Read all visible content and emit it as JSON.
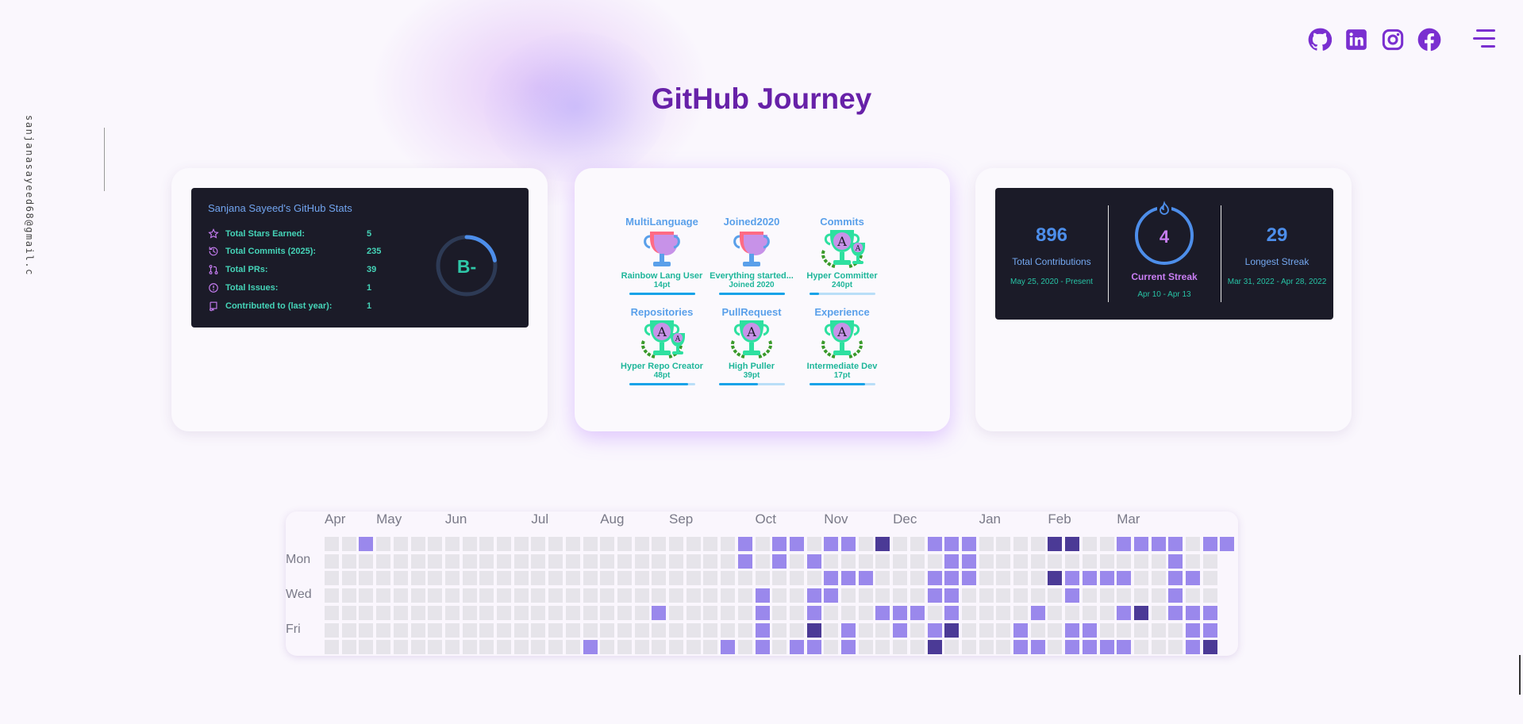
{
  "page": {
    "title": "GitHub Journey",
    "side_email": "sanjanasayeed68@gmail.c"
  },
  "header": {
    "socials": [
      "github-icon",
      "linkedin-icon",
      "instagram-icon",
      "facebook-icon"
    ],
    "menu_icon": "hamburger-menu-icon",
    "accent": "#7a2fd0"
  },
  "stats_card": {
    "title": "Sanjana Sayeed's GitHub Stats",
    "rows": [
      {
        "icon": "star-icon",
        "label": "Total Stars Earned:",
        "value": "5"
      },
      {
        "icon": "history-icon",
        "label": "Total Commits (2025):",
        "value": "235"
      },
      {
        "icon": "pull-request-icon",
        "label": "Total PRs:",
        "value": "39"
      },
      {
        "icon": "issue-icon",
        "label": "Total Issues:",
        "value": "1"
      },
      {
        "icon": "repo-icon",
        "label": "Contributed to (last year):",
        "value": "1"
      }
    ],
    "grade": "B-",
    "grade_progress": 0.22
  },
  "trophies": [
    {
      "name": "MultiLanguage",
      "title": "Rainbow Lang User",
      "points": "14pt",
      "rank": "",
      "progress": 1.0,
      "type": "rainbow"
    },
    {
      "name": "Joined2020",
      "title": "Everything started...",
      "points": "Joined 2020",
      "rank": "",
      "progress": 1.0,
      "type": "rainbow"
    },
    {
      "name": "Commits",
      "title": "Hyper Committer",
      "points": "240pt",
      "rank": "A",
      "progress": 0.15,
      "type": "double"
    },
    {
      "name": "Repositories",
      "title": "Hyper Repo Creator",
      "points": "48pt",
      "rank": "A",
      "progress": 0.9,
      "type": "double"
    },
    {
      "name": "PullRequest",
      "title": "High Puller",
      "points": "39pt",
      "rank": "A",
      "progress": 0.6,
      "type": "single"
    },
    {
      "name": "Experience",
      "title": "Intermediate Dev",
      "points": "17pt",
      "rank": "A",
      "progress": 0.85,
      "type": "single"
    }
  ],
  "streak_card": {
    "total": {
      "value": "896",
      "label": "Total Contributions",
      "range": "May 25, 2020 - Present"
    },
    "current": {
      "value": "4",
      "label": "Current Streak",
      "range": "Apr 10 - Apr 13"
    },
    "longest": {
      "value": "29",
      "label": "Longest Streak",
      "range": "Mar 31, 2022 - Apr 28, 2022"
    }
  },
  "contributions": {
    "months": [
      "Apr",
      "May",
      "Jun",
      "Jul",
      "Aug",
      "Sep",
      "Oct",
      "Nov",
      "Dec",
      "Jan",
      "Feb",
      "Mar"
    ],
    "month_weeks": [
      0,
      3,
      7,
      12,
      16,
      20,
      25,
      29,
      33,
      38,
      42,
      46
    ],
    "day_labels": [
      "Mon",
      "Wed",
      "Fri"
    ],
    "colors": {
      "empty": "#e6e4ea",
      "low": "#9a88ec",
      "high": "#4b3a96"
    },
    "cells": [
      [
        0,
        0,
        0,
        0,
        0,
        0,
        0,
        0,
        0,
        0,
        0,
        0,
        0,
        0,
        0,
        0,
        0,
        0,
        0,
        0,
        0,
        0,
        0,
        0,
        0,
        0,
        0
      ],
      [
        0,
        0,
        0,
        0,
        0,
        0,
        0,
        0,
        0,
        0,
        0,
        0,
        0,
        0,
        0,
        0,
        0,
        0,
        0,
        0,
        0,
        0,
        0,
        0,
        0,
        0,
        0
      ],
      [
        1,
        0,
        0,
        0,
        0,
        0,
        0,
        0,
        0,
        0,
        0,
        0,
        0,
        0,
        0,
        0,
        0,
        0,
        0,
        0,
        0,
        0,
        0,
        0,
        0,
        0,
        0
      ],
      [
        0,
        0,
        0,
        0,
        0,
        0,
        0,
        0,
        0,
        0,
        0,
        0,
        0,
        0,
        0,
        0,
        0,
        0,
        0,
        0,
        0,
        0,
        0,
        0,
        0,
        0,
        0
      ],
      [
        0,
        0,
        0,
        0,
        0,
        0,
        0,
        0,
        0,
        0,
        0,
        0,
        0,
        0,
        0,
        0,
        0,
        0,
        0,
        0,
        0,
        0,
        0,
        0,
        0,
        0,
        0
      ],
      [
        0,
        0,
        0,
        0,
        0,
        0,
        0,
        0,
        0,
        0,
        0,
        0,
        0,
        0,
        0,
        0,
        0,
        0,
        0,
        0,
        0,
        0,
        0,
        0,
        0,
        0,
        0
      ],
      [
        0,
        0,
        0,
        0,
        0,
        0,
        0,
        0,
        0,
        0,
        0,
        0,
        0,
        0,
        0,
        0,
        0,
        0,
        0,
        0,
        0,
        0,
        0,
        0,
        0,
        0,
        0
      ],
      [
        0,
        0,
        0,
        0,
        0,
        0,
        0,
        0,
        0,
        0,
        0,
        0,
        0,
        0,
        0,
        0,
        0,
        0,
        0,
        0,
        0,
        0,
        0,
        0,
        0,
        0,
        0
      ],
      [
        0,
        0,
        0,
        0,
        0,
        0,
        0,
        0,
        0,
        0,
        0,
        0,
        0,
        0,
        0,
        0,
        0,
        0,
        0,
        0,
        0,
        0,
        0,
        0,
        0,
        0,
        0
      ],
      [
        0,
        0,
        0,
        0,
        0,
        0,
        0,
        0,
        0,
        0,
        0,
        0,
        0,
        0,
        0,
        0,
        0,
        0,
        0,
        0,
        0,
        0,
        0,
        0,
        0,
        0,
        0
      ],
      [
        0,
        0,
        0,
        0,
        0,
        0,
        0,
        0,
        0,
        0,
        0,
        0,
        0,
        0,
        0,
        0,
        0,
        0,
        0,
        0,
        0,
        0,
        0,
        0,
        0,
        0,
        0
      ],
      [
        0,
        0,
        0,
        0,
        0,
        0,
        0,
        0,
        0,
        0,
        0,
        0,
        0,
        0,
        0,
        0,
        0,
        0,
        0,
        0,
        0,
        0,
        0,
        0,
        0,
        0,
        0
      ],
      [
        0,
        0,
        0,
        0,
        0,
        0,
        0,
        0,
        0,
        0,
        0,
        0,
        0,
        0,
        0,
        0,
        0,
        0,
        0,
        0,
        0,
        0,
        0,
        0,
        0,
        0,
        0
      ],
      [
        0,
        0,
        0,
        0,
        0,
        0,
        0,
        0,
        0,
        0,
        0,
        0,
        0,
        0,
        0,
        0,
        0,
        0,
        0,
        0,
        0,
        0,
        0,
        0,
        0,
        0,
        0
      ],
      [
        0,
        0,
        0,
        0,
        0,
        0,
        0,
        0,
        0,
        0,
        0,
        0,
        0,
        0,
        0,
        0,
        0,
        0,
        0,
        0,
        0,
        0,
        0,
        0,
        0,
        0,
        0
      ],
      [
        0,
        0,
        0,
        0,
        0,
        0,
        1,
        0,
        0,
        0,
        0,
        0,
        0,
        0,
        0,
        0,
        0,
        0,
        0,
        0,
        0,
        0,
        0,
        0,
        0,
        0,
        0
      ],
      [
        0,
        0,
        0,
        0,
        0,
        0,
        0,
        0,
        0,
        0,
        0,
        0,
        0,
        0,
        0,
        0,
        0,
        0,
        0,
        0,
        0,
        0,
        0,
        0,
        0,
        0,
        0
      ],
      [
        0,
        0,
        0,
        0,
        0,
        0,
        0,
        0,
        0,
        0,
        0,
        0,
        0,
        0,
        0,
        0,
        0,
        0,
        0,
        0,
        0,
        0,
        0,
        0,
        0,
        0,
        0
      ],
      [
        0,
        0,
        0,
        0,
        0,
        0,
        0,
        0,
        0,
        0,
        0,
        0,
        0,
        0,
        0,
        0,
        0,
        0,
        0,
        0,
        0,
        0,
        0,
        0,
        0,
        0,
        0
      ],
      [
        0,
        0,
        0,
        0,
        1,
        0,
        0,
        0,
        0,
        0,
        0,
        0,
        0,
        0,
        0,
        0,
        0,
        0,
        0,
        0,
        0,
        0,
        0,
        0,
        0,
        0,
        0
      ],
      [
        0,
        0,
        0,
        0,
        0,
        0,
        0,
        0,
        0,
        0,
        0,
        0,
        0,
        0,
        0,
        0,
        0,
        0,
        0,
        0,
        0,
        0,
        0,
        0,
        0,
        0,
        0
      ],
      [
        0,
        0,
        0,
        0,
        0,
        0,
        0,
        0,
        0,
        0,
        0,
        0,
        0,
        0,
        0,
        0,
        0,
        0,
        0,
        0,
        0,
        0,
        0,
        0,
        0,
        0,
        0
      ],
      [
        0,
        0,
        0,
        0,
        0,
        0,
        0,
        0,
        0,
        0,
        0,
        0,
        0,
        0,
        0,
        0,
        0,
        0,
        0,
        0,
        0,
        0,
        0,
        0,
        0,
        0,
        0
      ],
      [
        0,
        0,
        0,
        0,
        0,
        0,
        1,
        0,
        0,
        0,
        0,
        0,
        0,
        0,
        0,
        0,
        0,
        0,
        0,
        0,
        0,
        0,
        0,
        0,
        0,
        0,
        0
      ],
      [
        1,
        1,
        0,
        0,
        0,
        0,
        0,
        0,
        0,
        0,
        0,
        0,
        0,
        0,
        0,
        0,
        0,
        0,
        0,
        0,
        0,
        0,
        0,
        0,
        0,
        0,
        0
      ],
      [
        0,
        0,
        0,
        1,
        1,
        1,
        1,
        0,
        0,
        0,
        0,
        0,
        0,
        0,
        0,
        0,
        0,
        0,
        0,
        0,
        0,
        0,
        0,
        0,
        0,
        0,
        0
      ],
      [
        1,
        1,
        0,
        0,
        0,
        0,
        0,
        0,
        0,
        0,
        0,
        0,
        0,
        0,
        0,
        0,
        0,
        0,
        0,
        0,
        0,
        0,
        0,
        0,
        0,
        0,
        0
      ],
      [
        1,
        0,
        0,
        0,
        0,
        0,
        1,
        0,
        0,
        0,
        0,
        0,
        0,
        0,
        0,
        0,
        0,
        0,
        0,
        0,
        0,
        0,
        0,
        0,
        0,
        0,
        0
      ],
      [
        0,
        1,
        0,
        1,
        1,
        2,
        1,
        0,
        0,
        0,
        0,
        0,
        0,
        0,
        0,
        0,
        0,
        0,
        0,
        0,
        0,
        0,
        0,
        0,
        0,
        0,
        0
      ],
      [
        1,
        0,
        1,
        1,
        0,
        0,
        0,
        0,
        0,
        0,
        0,
        0,
        0,
        0,
        0,
        0,
        0,
        0,
        0,
        0,
        0,
        0,
        0,
        0,
        0,
        0,
        0
      ],
      [
        1,
        0,
        1,
        0,
        0,
        1,
        1,
        0,
        0,
        0,
        0,
        0,
        0,
        0,
        0,
        0,
        0,
        0,
        0,
        0,
        0,
        0,
        0,
        0,
        0,
        0,
        0
      ],
      [
        0,
        0,
        1,
        0,
        0,
        0,
        0,
        0,
        0,
        0,
        0,
        0,
        0,
        0,
        0,
        0,
        0,
        0,
        0,
        0,
        0,
        0,
        0,
        0,
        0,
        0,
        0
      ],
      [
        2,
        0,
        0,
        0,
        1,
        0,
        0,
        0,
        0,
        0,
        0,
        0,
        0,
        0,
        0,
        0,
        0,
        0,
        0,
        0,
        0,
        0,
        0,
        0,
        0,
        0,
        0
      ],
      [
        0,
        0,
        0,
        0,
        1,
        1,
        0,
        0,
        0,
        0,
        0,
        0,
        0,
        0,
        0,
        0,
        0,
        0,
        0,
        0,
        0,
        0,
        0,
        0,
        0,
        0,
        0
      ],
      [
        0,
        0,
        0,
        0,
        1,
        0,
        0,
        0,
        0,
        0,
        0,
        0,
        0,
        0,
        0,
        0,
        0,
        0,
        0,
        0,
        0,
        0,
        0,
        0,
        0,
        0,
        0
      ],
      [
        1,
        0,
        1,
        1,
        0,
        1,
        2,
        0,
        0,
        0,
        0,
        0,
        0,
        0,
        0,
        0,
        0,
        0,
        0,
        0,
        0,
        0,
        0,
        0,
        0,
        0,
        0
      ],
      [
        1,
        1,
        1,
        1,
        1,
        2,
        0,
        0,
        0,
        0,
        0,
        0,
        0,
        0,
        0,
        0,
        0,
        0,
        0,
        0,
        0,
        0,
        0,
        0,
        0,
        0,
        0
      ],
      [
        1,
        1,
        1,
        0,
        0,
        0,
        0,
        0,
        0,
        0,
        0,
        0,
        0,
        0,
        0,
        0,
        0,
        0,
        0,
        0,
        0,
        0,
        0,
        0,
        0,
        0,
        0
      ],
      [
        0,
        0,
        0,
        0,
        0,
        0,
        0,
        0,
        0,
        0,
        0,
        0,
        0,
        0,
        0,
        0,
        0,
        0,
        0,
        0,
        0,
        0,
        0,
        0,
        0,
        0,
        0
      ],
      [
        0,
        0,
        0,
        0,
        0,
        0,
        0,
        0,
        0,
        0,
        0,
        0,
        0,
        0,
        0,
        0,
        0,
        0,
        0,
        0,
        0,
        0,
        0,
        0,
        0,
        0,
        0
      ],
      [
        0,
        0,
        0,
        0,
        0,
        1,
        1,
        0,
        0,
        0,
        0,
        0,
        0,
        0,
        0,
        0,
        0,
        0,
        0,
        0,
        0,
        0,
        0,
        0,
        0,
        0,
        0
      ],
      [
        0,
        0,
        0,
        0,
        1,
        0,
        1,
        0,
        0,
        0,
        0,
        0,
        0,
        0,
        0,
        0,
        0,
        0,
        0,
        0,
        0,
        0,
        0,
        0,
        0,
        0,
        0
      ],
      [
        2,
        0,
        2,
        0,
        0,
        0,
        0,
        0,
        0,
        0,
        0,
        0,
        0,
        0,
        0,
        0,
        0,
        0,
        0,
        0,
        0,
        0,
        0,
        0,
        0,
        0,
        0
      ],
      [
        2,
        0,
        1,
        1,
        0,
        1,
        1,
        0,
        0,
        0,
        0,
        0,
        0,
        0,
        0,
        0,
        0,
        0,
        0,
        0,
        0,
        0,
        0,
        0,
        0,
        0,
        0
      ],
      [
        0,
        0,
        1,
        0,
        0,
        1,
        1,
        0,
        0,
        0,
        0,
        0,
        0,
        0,
        0,
        0,
        0,
        0,
        0,
        0,
        0,
        0,
        0,
        0,
        0,
        0,
        0
      ],
      [
        0,
        0,
        1,
        0,
        0,
        0,
        1,
        0,
        0,
        0,
        0,
        0,
        0,
        0,
        0,
        0,
        0,
        0,
        0,
        0,
        0,
        0,
        0,
        0,
        0,
        0,
        0
      ],
      [
        1,
        0,
        1,
        0,
        1,
        0,
        1,
        0,
        0,
        0,
        0,
        0,
        0,
        0,
        0,
        0,
        0,
        0,
        0,
        0,
        0,
        0,
        0,
        0,
        0,
        0,
        0
      ],
      [
        1,
        0,
        0,
        0,
        2,
        0,
        0,
        0,
        0,
        0,
        0,
        0,
        0,
        0,
        0,
        0,
        0,
        0,
        0,
        0,
        0,
        0,
        0,
        0,
        0,
        0,
        0
      ],
      [
        1,
        0,
        0,
        0,
        0,
        0,
        0,
        0,
        0,
        0,
        0,
        0,
        0,
        0,
        0,
        0,
        0,
        0,
        0,
        0,
        0,
        0,
        0,
        0,
        0,
        0,
        0
      ],
      [
        1,
        1,
        1,
        1,
        1,
        0,
        0,
        0,
        0,
        0,
        0,
        0,
        0,
        0,
        0,
        0,
        0,
        0,
        0,
        0,
        0,
        0,
        0,
        0,
        0,
        0,
        0
      ],
      [
        0,
        0,
        1,
        0,
        1,
        1,
        1,
        0,
        0,
        0,
        0,
        0,
        0,
        0,
        0,
        0,
        0,
        0,
        0,
        0,
        0,
        0,
        0,
        0,
        0,
        0,
        0
      ],
      [
        1,
        0,
        0,
        0,
        1,
        1,
        2,
        0,
        0,
        0,
        0,
        0,
        0,
        0,
        0,
        0,
        0,
        0,
        0,
        0,
        0,
        0,
        0,
        0,
        0,
        0,
        0
      ],
      [
        1,
        0,
        0,
        0,
        0,
        0,
        0,
        0,
        0,
        0,
        0,
        0,
        0,
        0,
        0,
        0,
        0,
        0,
        0,
        0,
        0,
        0,
        0,
        0,
        0,
        0,
        0
      ]
    ]
  }
}
